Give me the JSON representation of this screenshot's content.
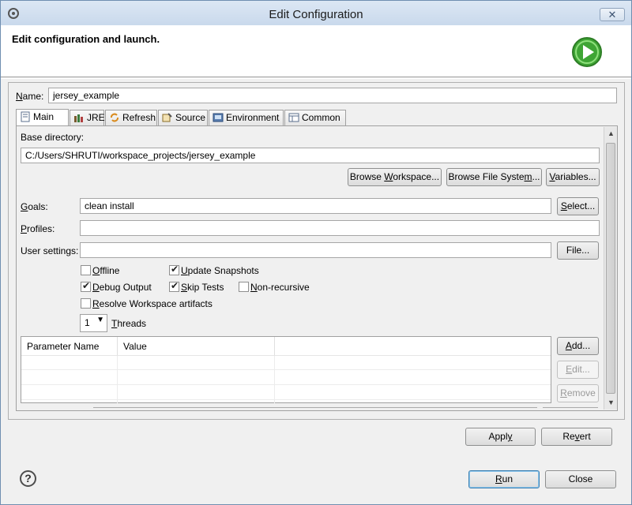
{
  "window": {
    "title": "Edit Configuration"
  },
  "banner": {
    "heading": "Edit configuration and launch."
  },
  "name": {
    "label": "Name:",
    "value": "jersey_example"
  },
  "tabs": [
    {
      "label": "Main",
      "icon": "document-icon"
    },
    {
      "label": "JRE",
      "icon": "library-icon"
    },
    {
      "label": "Refresh",
      "icon": "refresh-icon"
    },
    {
      "label": "Source",
      "icon": "source-icon"
    },
    {
      "label": "Environment",
      "icon": "environment-icon"
    },
    {
      "label": "Common",
      "icon": "common-icon"
    }
  ],
  "main": {
    "base_dir_label": "Base directory:",
    "base_dir_value": "C:/Users/SHRUTI/workspace_projects/jersey_example",
    "browse_workspace": "Browse Workspace...",
    "browse_fs": "Browse File System...",
    "variables": "Variables...",
    "goals_label": "Goals:",
    "goals_value": "clean install",
    "select": "Select...",
    "profiles_label": "Profiles:",
    "profiles_value": "",
    "user_settings_label": "User settings:",
    "user_settings_value": "",
    "file": "File...",
    "options": {
      "offline": {
        "label": "Offline",
        "checked": false
      },
      "update_snapshots": {
        "label": "Update Snapshots",
        "checked": true
      },
      "debug_output": {
        "label": "Debug Output",
        "checked": true
      },
      "skip_tests": {
        "label": "Skip Tests",
        "checked": true
      },
      "non_recursive": {
        "label": "Non-recursive",
        "checked": false
      },
      "resolve_workspace": {
        "label": "Resolve Workspace artifacts",
        "checked": false
      }
    },
    "threads_value": "1",
    "threads_label": "Threads",
    "params": {
      "col_name": "Parameter Name",
      "col_value": "Value",
      "rows": []
    },
    "add": "Add...",
    "edit": "Edit...",
    "remove": "Remove"
  },
  "buttons": {
    "apply": "Apply",
    "revert": "Revert",
    "run": "Run",
    "close": "Close"
  },
  "colors": {
    "accent": "#3c7fb1",
    "run_green": "#3fa535"
  }
}
